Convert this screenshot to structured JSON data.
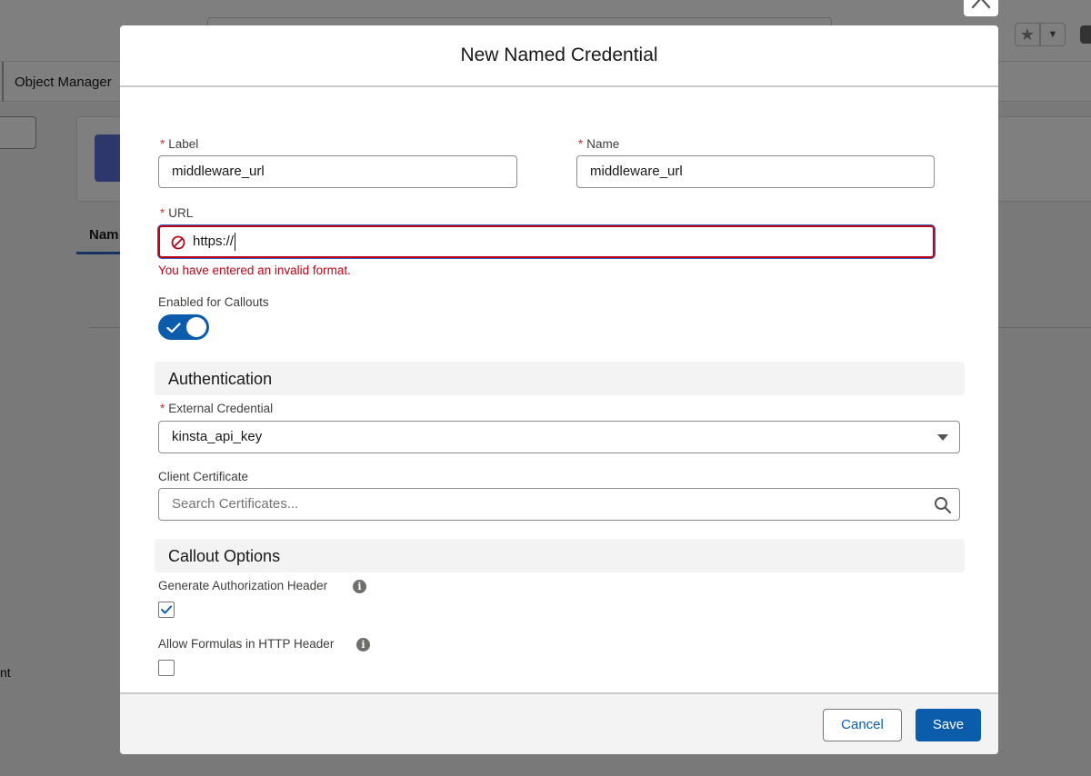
{
  "background": {
    "nav_tab_label": "Object Manager",
    "list_header_fragment": "Nam",
    "sidebar_fragment": "nt",
    "star_icon": "star-icon",
    "chevron_icon": "chevron-down-icon"
  },
  "modal": {
    "title": "New Named Credential",
    "close_icon": "close-icon",
    "fields": {
      "label": {
        "label": "Label",
        "required": true,
        "value": "middleware_url"
      },
      "name": {
        "label": "Name",
        "required": true,
        "value": "middleware_url"
      },
      "url": {
        "label": "URL",
        "required": true,
        "value": "https://",
        "error": "You have entered an invalid format.",
        "error_icon": "error-ban-icon"
      },
      "enabled_for_callouts": {
        "label": "Enabled for Callouts",
        "checked": true
      }
    },
    "sections": {
      "authentication": {
        "title": "Authentication",
        "external_credential": {
          "label": "External Credential",
          "required": true,
          "value": "kinsta_api_key"
        },
        "client_certificate": {
          "label": "Client Certificate",
          "placeholder": "Search Certificates...",
          "icon": "search-icon"
        }
      },
      "callout_options": {
        "title": "Callout Options",
        "generate_auth_header": {
          "label": "Generate Authorization Header",
          "checked": true,
          "icon": "info-icon"
        },
        "allow_formulas": {
          "label": "Allow Formulas in HTTP Header",
          "checked": false,
          "icon": "info-icon"
        }
      }
    },
    "footer": {
      "cancel_label": "Cancel",
      "save_label": "Save"
    }
  },
  "colors": {
    "brand": "#0b5cab",
    "error": "#ba0517",
    "required": "#c23934"
  }
}
